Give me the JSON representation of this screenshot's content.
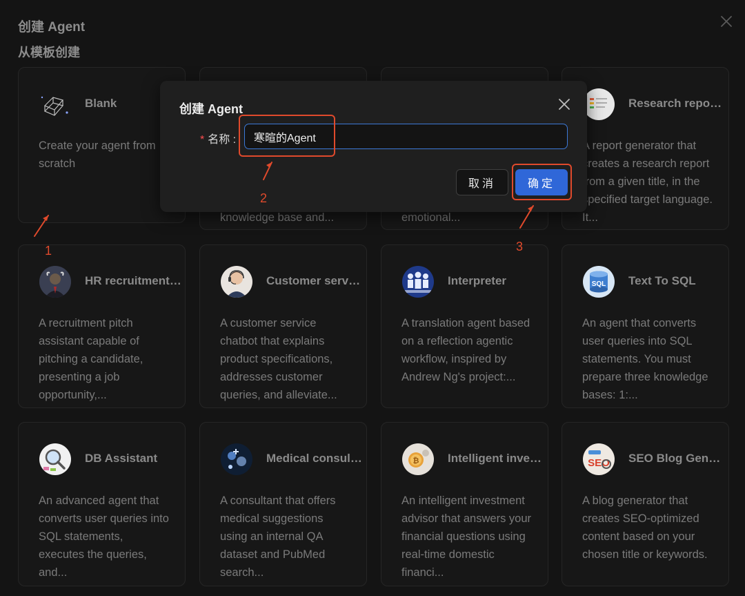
{
  "header": {
    "title": "创建 Agent",
    "section": "从模板创建"
  },
  "templates": [
    {
      "title": "Blank",
      "desc": "Create your agent from scratch",
      "icon": "cube-wireframe-icon"
    },
    {
      "title": "",
      "desc": "knowledge base and...",
      "icon": ""
    },
    {
      "title": "",
      "desc": "emotional...",
      "icon": ""
    },
    {
      "title": "Research report generator",
      "desc": "A report generator that creates a research report from a given title, in the specified target language. It...",
      "icon": "research-chart-icon"
    },
    {
      "title": "HR recruitment pitch assistant",
      "desc": "A recruitment pitch assistant capable of pitching a candidate, presenting a job opportunity,...",
      "icon": "hr-avatar-icon"
    },
    {
      "title": "Customer service",
      "desc": "A customer service chatbot that explains product specifications, addresses customer queries, and alleviate...",
      "icon": "headset-agent-icon"
    },
    {
      "title": "Interpreter",
      "desc": "A translation agent based on a reflection agentic workflow, inspired by Andrew Ng's project:...",
      "icon": "interpreter-icon"
    },
    {
      "title": "Text To SQL",
      "desc": "An agent that converts user queries into SQL statements. You must prepare three knowledge bases: 1:...",
      "icon": "sql-database-icon"
    },
    {
      "title": "DB Assistant",
      "desc": "An advanced agent that converts user queries into SQL statements, executes the queries, and...",
      "icon": "db-query-icon"
    },
    {
      "title": "Medical consultant",
      "desc": "A consultant that offers medical suggestions using an internal QA dataset and PubMed search...",
      "icon": "medical-icon"
    },
    {
      "title": "Intelligent investment advisor",
      "desc": "An intelligent investment advisor that answers your financial questions using real-time domestic financi...",
      "icon": "investment-coin-icon"
    },
    {
      "title": "SEO Blog Generator",
      "desc": "A blog generator that creates SEO-optimized content based on your chosen title or keywords.",
      "icon": "seo-blog-icon"
    }
  ],
  "dialog": {
    "title": "创建 Agent",
    "required_mark": "*",
    "name_label": "名称 :",
    "name_value": "寒暄的Agent",
    "cancel_label": "取消",
    "ok_label": "确定"
  },
  "annotations": {
    "step1": "1",
    "step2": "2",
    "step3": "3"
  },
  "colors": {
    "background": "#141414",
    "card": "#171717",
    "dialog": "#1f1f1f",
    "primary": "#2f67d8",
    "annotation": "#e04a2c",
    "required": "#ff4d4f"
  }
}
